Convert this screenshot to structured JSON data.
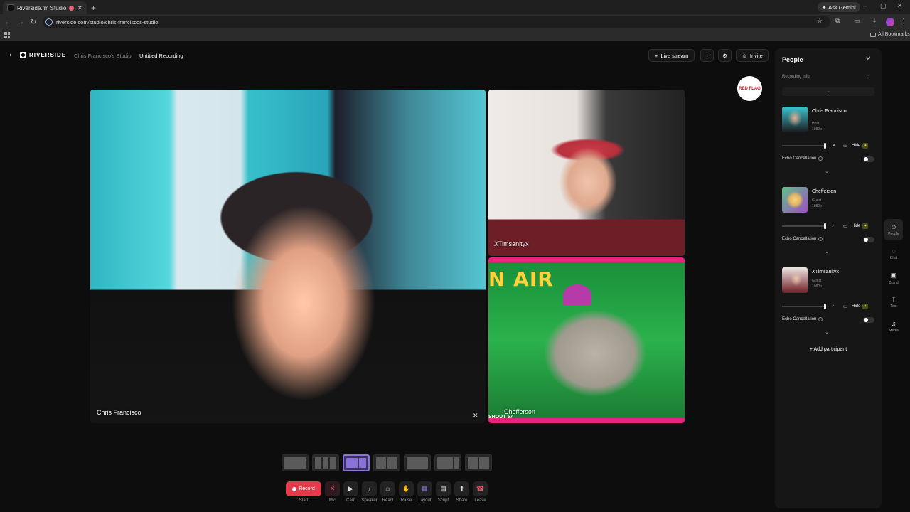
{
  "browser": {
    "tab_title": "Riverside.fm Studio | Chris",
    "tab_close": "✕",
    "new_tab": "+",
    "ask_gemini": "Ask Gemini",
    "url": "riverside.com/studio/chris-franciscos-studio",
    "all_bookmarks": "All Bookmarks"
  },
  "studio": {
    "brand": "RIVERSIDE",
    "studio_name": "Chris Francisco's Studio",
    "recording_title": "Untitled Recording",
    "live_stream": "Live stream",
    "invite": "Invite",
    "redflag_badge": "RED FLAG"
  },
  "tiles": {
    "main_name": "Chris Francisco",
    "guest1_name": "XTimsanityx",
    "guest2_name": "Chefferson",
    "guest2_overlay": "N AIR",
    "guest2_corner": "SHOUT 57"
  },
  "layouts": {
    "count": 7,
    "active_index": 2
  },
  "controls": [
    {
      "label": "Start",
      "button": "Record"
    },
    {
      "label": "Mic"
    },
    {
      "label": "Cam"
    },
    {
      "label": "Speaker"
    },
    {
      "label": "React"
    },
    {
      "label": "Raise"
    },
    {
      "label": "Layout"
    },
    {
      "label": "Script"
    },
    {
      "label": "Share"
    },
    {
      "label": "Leave"
    }
  ],
  "people_panel": {
    "title": "People",
    "recording_info": "Recording info",
    "participants": [
      {
        "name": "Chris Francisco",
        "role": "Host",
        "resolution": "1080p",
        "hide": "Hide",
        "echo": "Echo Cancellation"
      },
      {
        "name": "Chefferson",
        "role": "Guest",
        "resolution": "1080p",
        "hide": "Hide",
        "echo": "Echo Cancellation"
      },
      {
        "name": "XTimsanityx",
        "role": "Guest",
        "resolution": "1080p",
        "hide": "Hide",
        "echo": "Echo Cancellation"
      }
    ],
    "add_participant": "Add participant"
  },
  "rail": [
    {
      "label": "People",
      "icon": "people-icon"
    },
    {
      "label": "Chat",
      "icon": "chat-icon"
    },
    {
      "label": "Brand",
      "icon": "brand-icon"
    },
    {
      "label": "Text",
      "icon": "text-icon"
    },
    {
      "label": "Media",
      "icon": "media-icon"
    }
  ],
  "colors": {
    "record": "#e23b4b",
    "layout_accent": "#8a73d8",
    "background": "#0d0d0d"
  }
}
